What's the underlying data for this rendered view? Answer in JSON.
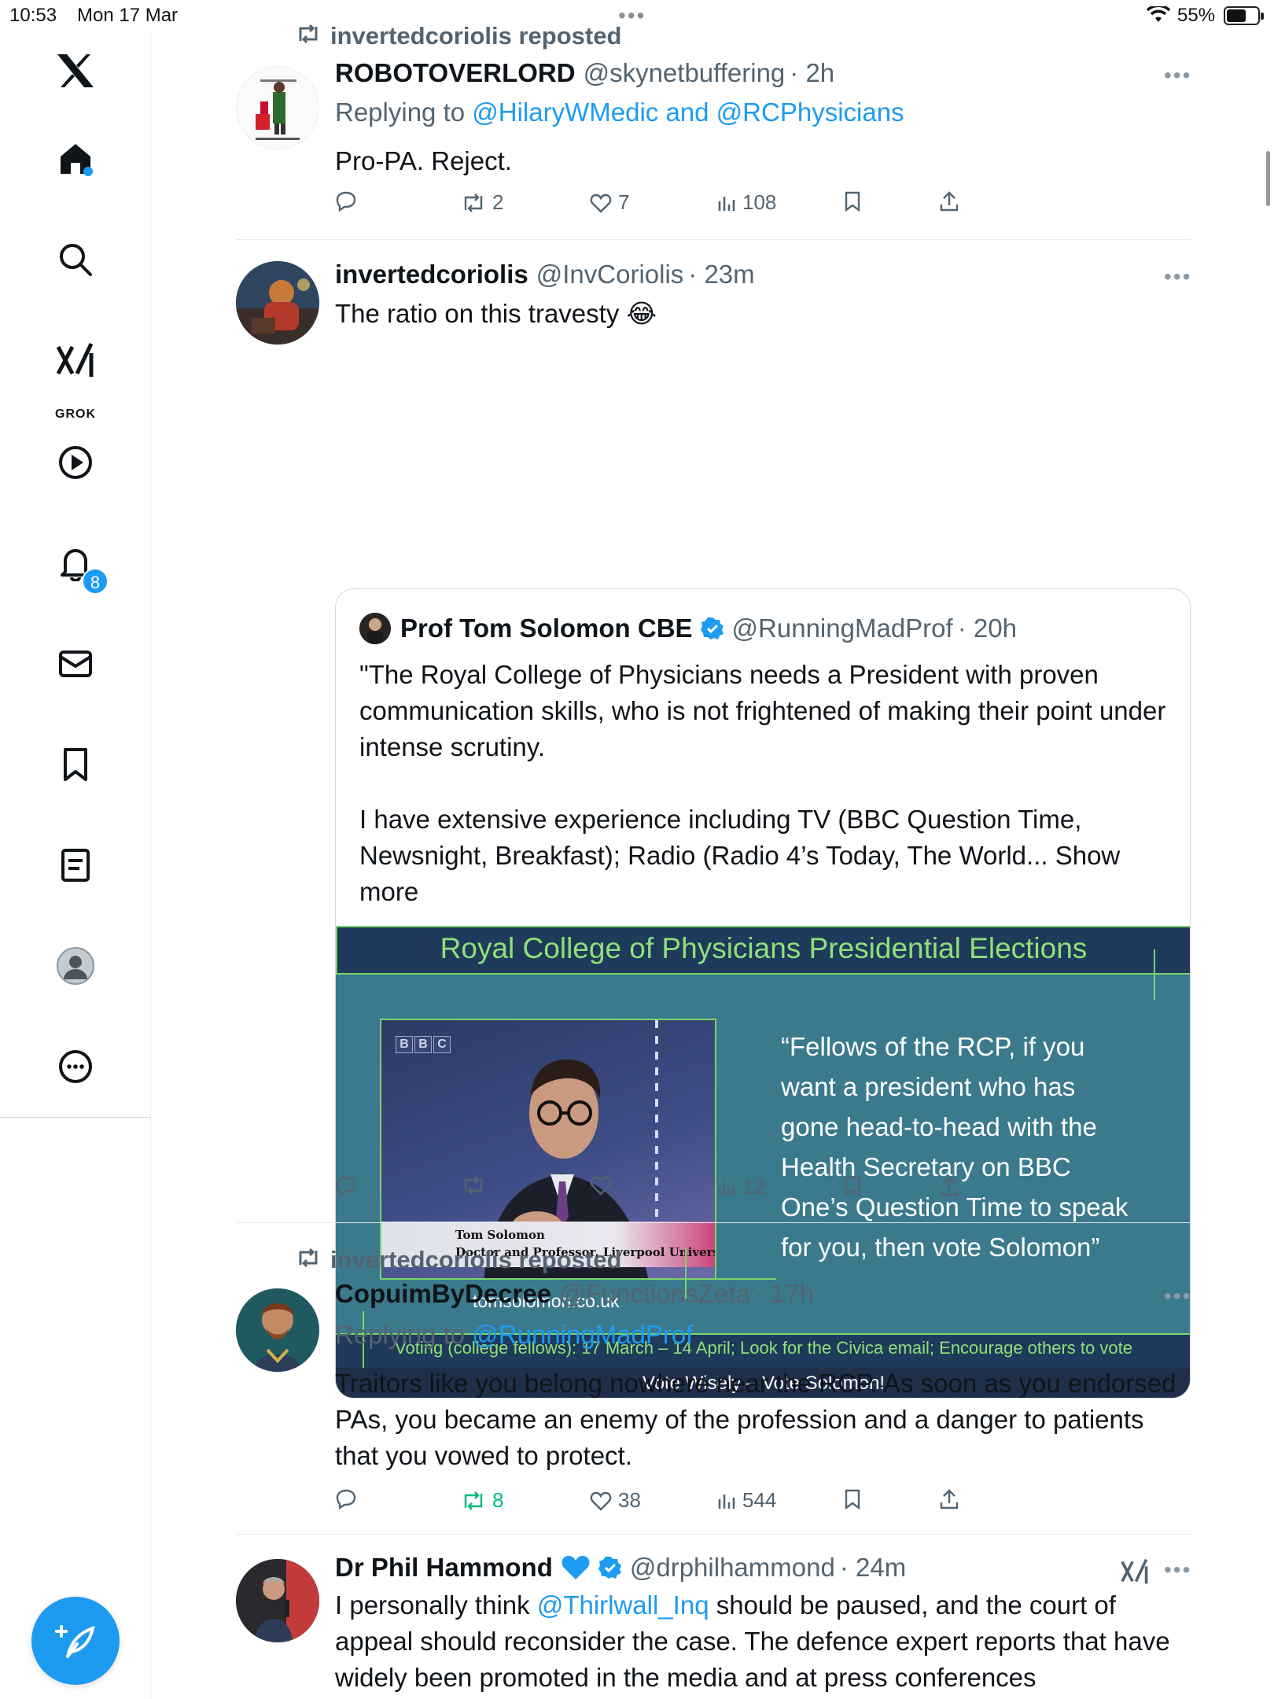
{
  "status_bar": {
    "time": "10:53",
    "date": "Mon 17 Mar",
    "battery": "55%"
  },
  "sidebar": {
    "grok_label": "GROK",
    "notification_count": "8",
    "items": [
      "x-logo",
      "home",
      "search",
      "grok",
      "video",
      "notifications",
      "messages",
      "bookmarks",
      "lists",
      "profile",
      "more"
    ]
  },
  "tweets": [
    {
      "repost_label": "invertedcoriolis reposted",
      "name": "ROBOTOVERLORD",
      "handle": "@skynetbuffering",
      "time": "· 2h",
      "replying_prefix": "Replying to ",
      "replying_to": "@HilaryWMedic and @RCPhysicians",
      "text": "Pro-PA. Reject.",
      "replies": "",
      "reposts": "2",
      "likes": "7",
      "views": "108"
    },
    {
      "name": "invertedcoriolis",
      "handle": "@InvCoriolis",
      "time": "· 23m",
      "text": "The ratio on this travesty 😂",
      "views": "12",
      "quote": {
        "name": "Prof Tom Solomon CBE",
        "handle": "@RunningMadProf",
        "time": "· 20h",
        "text_p1": "\"The Royal College of Physicians needs a President with proven communication skills, who is not frightened of making their point under intense scrutiny.",
        "text_p2": "I have extensive  experience including TV (BBC Question Time, Newsnight, Breakfast); Radio (Radio 4’s Today, The World... Show more",
        "poster": {
          "title": "Royal College of Physicians Presidential Elections",
          "bbc": [
            "B",
            "B",
            "C"
          ],
          "caption_name": "Tom Solomon",
          "caption_role": "Doctor and Professor, Liverpool University",
          "url": "tomsolomon.co.uk",
          "quote_text": "“Fellows of the RCP, if you want a president who has gone head-to-head with the Health Secretary on BBC One’s Question Time to speak for you, then vote Solomon”",
          "voting_text": "Voting (college fellows): 17 March – 14 April; Look for the Civica email; Encourage others to vote",
          "slogan": "Vote Wisely – Vote Solomon!"
        }
      }
    },
    {
      "repost_label": "invertedcoriolis reposted",
      "name": "CopuimByDecree",
      "handle": "@FunctionsZeta",
      "time": "· 17h",
      "replying_prefix": "Replying to ",
      "replying_to": "@RunningMadProf",
      "text": "Traitors like you belong nowhere near the RCP. As soon as you endorsed PAs, you became an enemy of the profession and a danger to patients that you vowed to protect.",
      "reposts": "8",
      "likes": "38",
      "views": "544"
    },
    {
      "name": "Dr Phil Hammond",
      "handle": "@drphilhammond",
      "time": "· 24m",
      "text_mention": "@Thirlwall_Inq",
      "text_prefix": "I personally think ",
      "text_suffix": " should be paused, and the court of appeal should reconsider the case. The defence expert reports that have widely been promoted in the media and at press conferences"
    }
  ],
  "colors": {
    "accent": "#1d9bf0",
    "repost_active": "#00ba7c",
    "poster_bg": "#3b7a8c",
    "poster_title": "#8fe07a"
  }
}
